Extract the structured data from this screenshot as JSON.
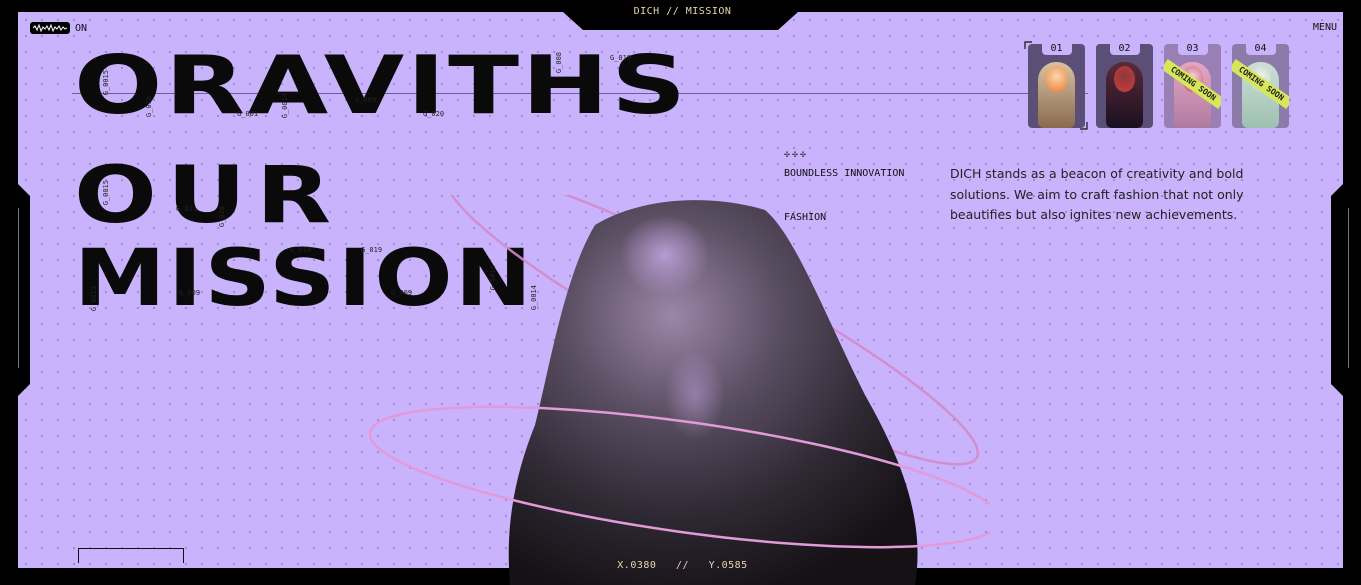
{
  "header": {
    "title": "DICH // MISSION",
    "status": "ON",
    "menu": "MENU"
  },
  "hero": {
    "line1": "ORAVITHS",
    "line2": "OUR",
    "line3": "MISSION",
    "glyph_labels": [
      "G_0015",
      "G_018",
      "G_001",
      "G_0014",
      "G_009",
      "G_020",
      "G_008",
      "G_019",
      "G_0015",
      "G_021",
      "G_018",
      "G_019",
      "G_019",
      "G_0013",
      "G_009",
      "G_009",
      "G_0015",
      "G_0014"
    ]
  },
  "cards": [
    {
      "num": "01",
      "badge": "",
      "colors": [
        "#f07a2c",
        "#d9c2a0"
      ]
    },
    {
      "num": "02",
      "badge": "",
      "colors": [
        "#d33a3a",
        "#3a1f2f"
      ]
    },
    {
      "num": "03",
      "badge": "COMING SOON",
      "colors": [
        "#e3a7c2",
        "#c64a5e"
      ]
    },
    {
      "num": "04",
      "badge": "COMING SOON",
      "colors": [
        "#cfe0d6",
        "#9cc0b1"
      ]
    }
  ],
  "info": {
    "stars": "✢✢✢",
    "tag1": "BOUNDLESS INNOVATION",
    "tag2": "FASHION",
    "description": "DICH stands as a beacon of creativity and bold solutions. We aim to craft fashion that not only beautifies but also ignites new achievements."
  },
  "coords": {
    "text": "X.0380   //   Y.0585"
  },
  "colors": {
    "background": "#c9b3fc",
    "frame": "#000000",
    "accent": "#e8d6ad",
    "ribbon": "#d6e85a"
  }
}
